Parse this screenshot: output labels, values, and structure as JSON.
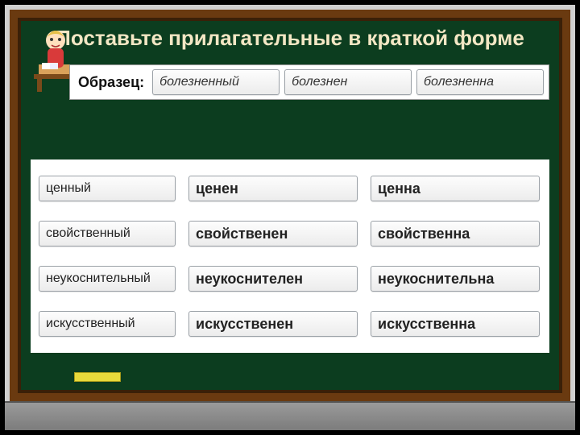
{
  "title": "Поставьте прилагательные в краткой форме",
  "sample": {
    "label": "Образец:",
    "full": "болезненный",
    "short_m": "болезнен",
    "short_f": "болезненна"
  },
  "rows": [
    {
      "full": "ценный",
      "short_m": "ценен",
      "short_f": "ценна"
    },
    {
      "full": "свойственный",
      "short_m": "свойственен",
      "short_f": "свойственна"
    },
    {
      "full": "неукоснительный",
      "short_m": "неукоснителен",
      "short_f": "неукоснительна"
    },
    {
      "full": "искусственный",
      "short_m": "искусственен",
      "short_f": "искусственна"
    }
  ],
  "illustration": {
    "name": "student-at-desk-icon"
  },
  "colors": {
    "board": "#0c3d1f",
    "frame": "#6a3a10",
    "title": "#f3e7c4"
  }
}
